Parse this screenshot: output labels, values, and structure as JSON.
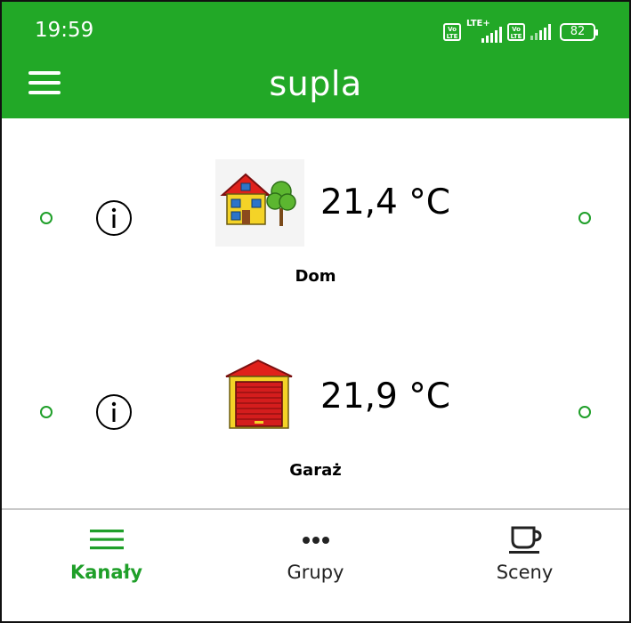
{
  "status_bar": {
    "time": "19:59",
    "sim1_badge": "Vo LTE",
    "network_type": "LTE+",
    "sim2_badge": "Vo LTE",
    "battery": "82"
  },
  "app_bar": {
    "title": "supla"
  },
  "channels": [
    {
      "icon": "house-with-tree-icon",
      "temperature": "21,4 °C",
      "caption": "Dom"
    },
    {
      "icon": "garage-icon",
      "temperature": "21,9 °C",
      "caption": "Garaż"
    }
  ],
  "bottom_nav": {
    "items": [
      {
        "label": "Kanały",
        "icon": "list-icon",
        "active": true
      },
      {
        "label": "Grupy",
        "icon": "more-dots-icon",
        "active": false
      },
      {
        "label": "Sceny",
        "icon": "cup-icon",
        "active": false
      }
    ]
  },
  "colors": {
    "brand_green": "#22a827",
    "online_dot": "#1f9f29",
    "house_red": "#e0211b",
    "house_yellow": "#f4d327"
  }
}
